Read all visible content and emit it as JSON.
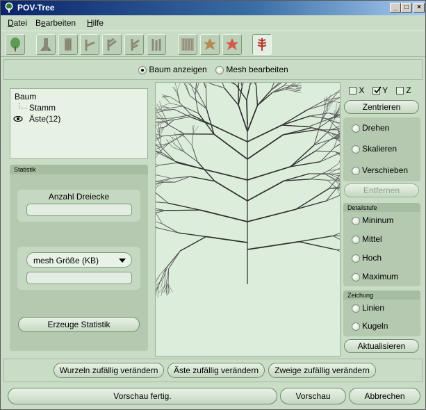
{
  "window": {
    "title": "POV-Tree",
    "minimize": "_",
    "maximize": "□",
    "close": "×"
  },
  "menu": [
    {
      "label": "Datei",
      "underline": "D",
      "rest": "atei"
    },
    {
      "label": "Bearbeiten",
      "underline": "e",
      "pre": "B",
      "rest": "arbeiten"
    },
    {
      "label": "Hilfe",
      "underline": "H",
      "rest": "ilfe"
    }
  ],
  "toolbar": {
    "icons": [
      "tree-icon",
      "trunk-icon",
      "bark-icon",
      "branch-1-icon",
      "branch-2-icon",
      "branch-3-icon",
      "branch-4-icon",
      "texture-icon",
      "leaf-green-icon",
      "leaf-red-icon",
      "fern-icon"
    ]
  },
  "mode": {
    "show_tree": "Baum anzeigen",
    "edit_mesh": "Mesh bearbeiten",
    "selected": "show_tree"
  },
  "tree": {
    "root": "Baum",
    "children": [
      "Stamm",
      "Äste(12)"
    ]
  },
  "statistik": {
    "header": "Statistik",
    "triangles_label": "Anzahl Dreiecke",
    "triangles_value": "",
    "mesh_select": "mesh Größe (KB)",
    "mesh_value": "",
    "generate_button": "Erzeuge Statistik"
  },
  "axes": {
    "x": "X",
    "y": "Y",
    "z": "Z",
    "x_checked": false,
    "y_checked": true,
    "z_checked": false
  },
  "view": {
    "center_button": "Zentrieren",
    "rotate": "Drehen",
    "scale": "Skalieren",
    "move": "Verschieben",
    "remove_button": "Entfernen"
  },
  "detail": {
    "header": "Detailstufe",
    "options": [
      "Mininum",
      "Mittel",
      "Hoch",
      "Maximum"
    ]
  },
  "drawing": {
    "header": "Zeichung",
    "options": [
      "Linien",
      "Kugeln"
    ],
    "update_button": "Aktualisieren"
  },
  "random": {
    "roots": "Wurzeln zufällig verändern",
    "branches": "Äste zufällig verändern",
    "twigs": "Zweige zufällig verändern"
  },
  "status": {
    "message": "Vorschau fertig.",
    "preview_button": "Vorschau",
    "cancel_button": "Abbrechen"
  },
  "colors": {
    "titlebar": "#0a246a",
    "panel": "#c9dcc6",
    "viewport": "#dceedb",
    "tree_strokes": "#3a3a3a"
  }
}
